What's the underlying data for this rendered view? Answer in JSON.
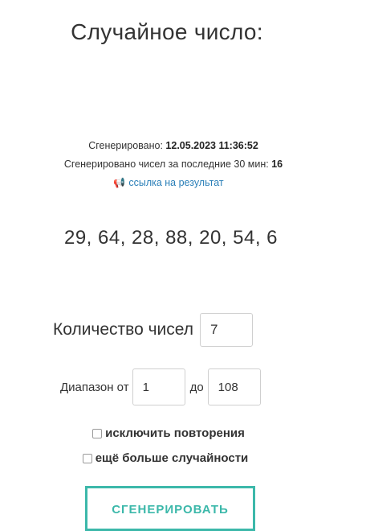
{
  "header": {
    "title": "Случайное число:"
  },
  "meta": {
    "generated_label": "Сгенерировано:",
    "generated_value": "12.05.2023 11:36:52",
    "count_label": "Сгенерировано чисел за последние 30 мин:",
    "count_value": "16"
  },
  "link": {
    "icon": "megaphone-icon",
    "text": "ссылка на результат"
  },
  "result": {
    "numbers": "29, 64, 28, 88, 20, 54, 6"
  },
  "form": {
    "count_label": "Количество чисел",
    "count_value": "7",
    "range_label": "Диапазон от",
    "from_value": "1",
    "to_label": "до",
    "to_value": "108",
    "exclude_repeats_label": "исключить повторения",
    "exclude_repeats_checked": false,
    "more_random_label": "ещё больше случайности",
    "more_random_checked": false,
    "generate_label": "СГЕНЕРИРОВАТЬ"
  },
  "colors": {
    "accent": "#3cb8aa",
    "link": "#2a7fb8",
    "text": "#333333"
  }
}
